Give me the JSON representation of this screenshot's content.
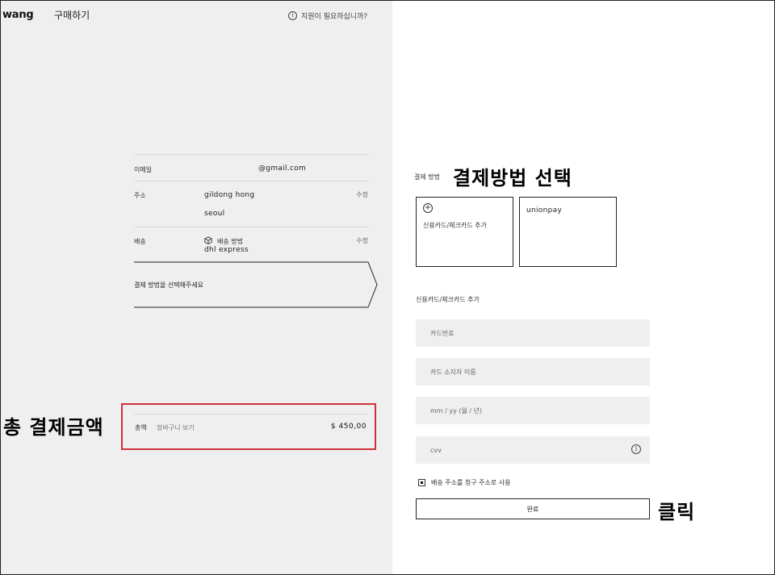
{
  "header": {
    "logo": "wang",
    "title": "구매하기",
    "help": "지원이 필요하십니까?"
  },
  "summary": {
    "email": {
      "label": "이메일",
      "value": "@gmail.com"
    },
    "address": {
      "label": "주소",
      "name": "gildong hong",
      "city": "seoul",
      "edit": "수정"
    },
    "shipping": {
      "label": "배송",
      "method_label": "배송 방법",
      "method": "dhl express",
      "edit": "수정"
    },
    "next_step": "결제 방법을 선택해주세요"
  },
  "total": {
    "label": "총액",
    "cart_link": "장바구니 보기",
    "amount": "$ 450,00"
  },
  "payment": {
    "label": "결제 방법",
    "options": [
      {
        "label": "신용카드/체크카드 추가",
        "icon": "plus-circle-icon"
      },
      {
        "label": "unionpay"
      }
    ],
    "form_title": "신용카드/체크카드 추가",
    "fields": {
      "card_number": "카드번호",
      "holder_name": "카드 소지자 이름",
      "expiry": "mm / yy (월 / 년)",
      "cvv": "cvv"
    },
    "billing_same": "배송 주소를 청구 주소로 사용",
    "submit": "완료"
  },
  "annotations": {
    "total": "총 결제금액",
    "payment_method": "결제방법 선택",
    "click": "클릭"
  },
  "colors": {
    "highlight_border": "#d0313a",
    "left_panel_bg": "#efefef"
  }
}
